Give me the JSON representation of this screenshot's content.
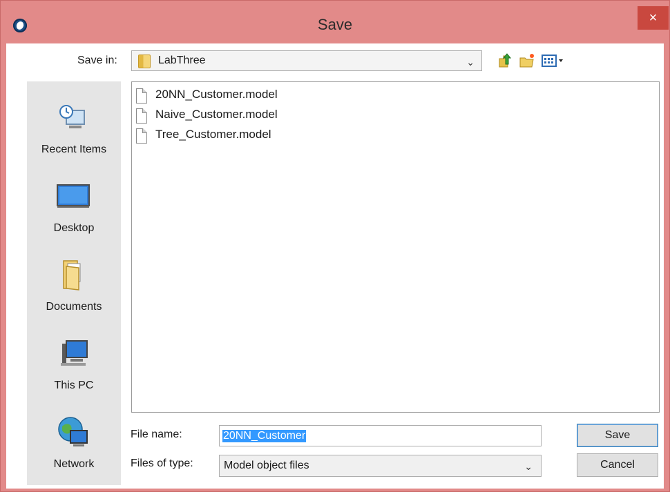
{
  "window": {
    "title": "Save",
    "close_label": "×"
  },
  "header": {
    "save_in_label": "Save in:",
    "save_in_value": "LabThree"
  },
  "toolbar": {
    "icons": [
      "up-one-level-icon",
      "new-folder-icon",
      "view-menu-icon"
    ]
  },
  "places": [
    {
      "label": "Recent Items",
      "icon": "recent-items-icon"
    },
    {
      "label": "Desktop",
      "icon": "desktop-icon"
    },
    {
      "label": "Documents",
      "icon": "documents-icon"
    },
    {
      "label": "This PC",
      "icon": "this-pc-icon"
    },
    {
      "label": "Network",
      "icon": "network-icon"
    }
  ],
  "files": [
    {
      "name": "20NN_Customer.model"
    },
    {
      "name": "Naive_Customer.model"
    },
    {
      "name": "Tree_Customer.model"
    }
  ],
  "form": {
    "file_name_label": "File name:",
    "file_name_value": "20NN_Customer",
    "file_type_label": "Files of type:",
    "file_type_value": "Model object files"
  },
  "buttons": {
    "save": "Save",
    "cancel": "Cancel"
  },
  "colors": {
    "titlebar": "#e28a89",
    "close_button": "#c9483f",
    "selection": "#3399ff"
  }
}
